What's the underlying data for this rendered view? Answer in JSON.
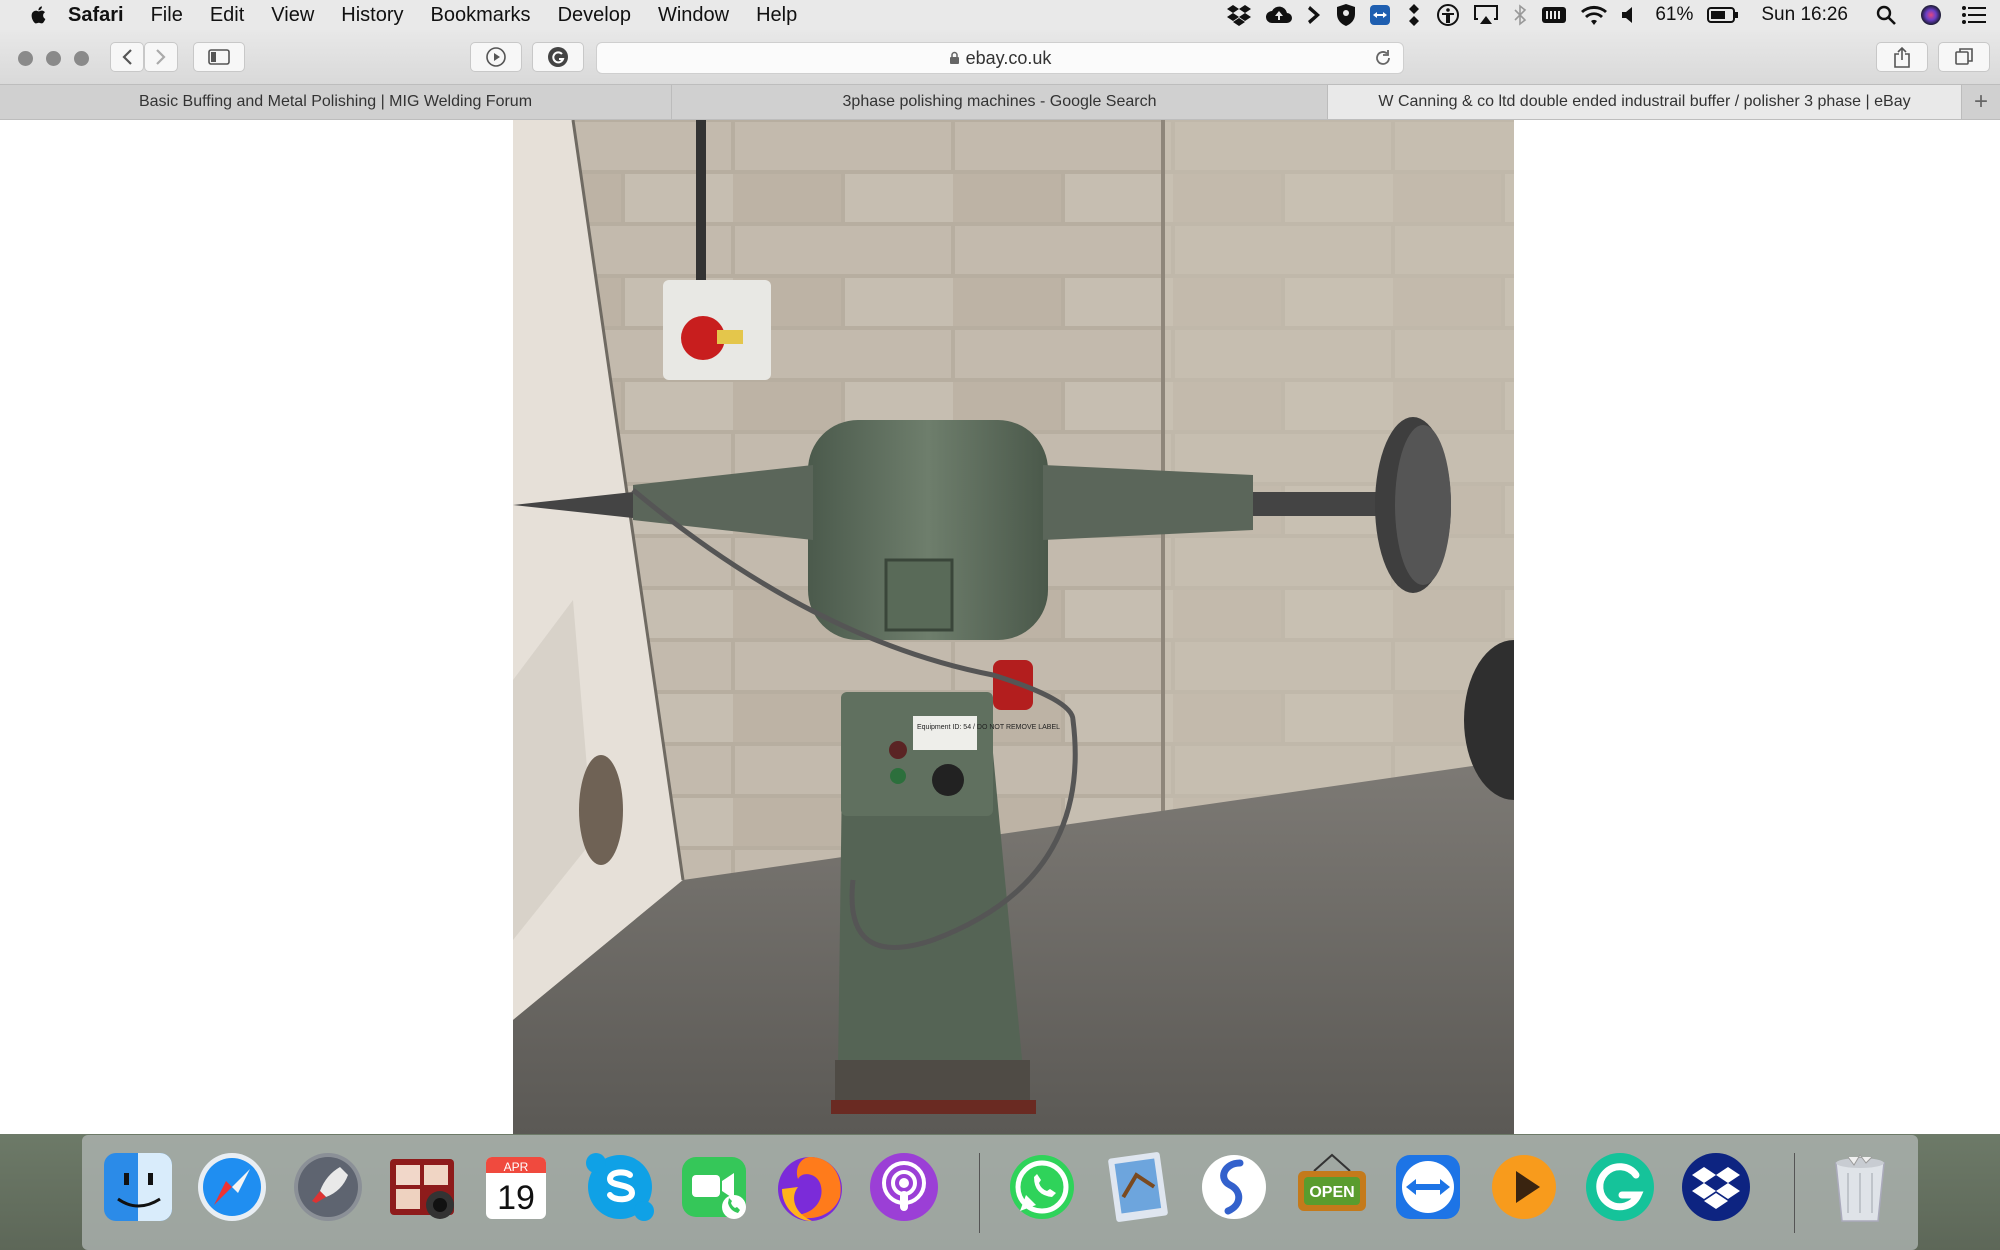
{
  "menubar": {
    "app": "Safari",
    "items": [
      "File",
      "Edit",
      "View",
      "History",
      "Bookmarks",
      "Develop",
      "Window",
      "Help"
    ],
    "battery": "61%",
    "clock": "Sun 16:26"
  },
  "toolbar": {
    "address": "ebay.co.uk"
  },
  "tabs": [
    {
      "title": "Basic Buffing and Metal Polishing | MIG Welding Forum"
    },
    {
      "title": "3phase polishing machines - Google Search"
    },
    {
      "title": "W Canning & co ltd double ended industrail buffer / polisher 3 phase  | eBay"
    }
  ],
  "photo": {
    "label_text": "Equipment ID: 54 / DO NOT REMOVE LABEL"
  },
  "dock": {
    "calendar_month": "APR",
    "calendar_day": "19",
    "open_sign": "OPEN",
    "icons": [
      "finder-icon",
      "safari-icon",
      "launchpad-icon",
      "photo-booth-icon",
      "calendar-icon",
      "skype-icon",
      "facetime-icon",
      "firefox-icon",
      "podcasts-icon",
      "whatsapp-icon",
      "preview-icon",
      "simplenote-icon",
      "open-sign-icon",
      "teamviewer-icon",
      "infuse-icon",
      "grammarly-icon",
      "dropbox-icon",
      "trash-icon"
    ]
  }
}
